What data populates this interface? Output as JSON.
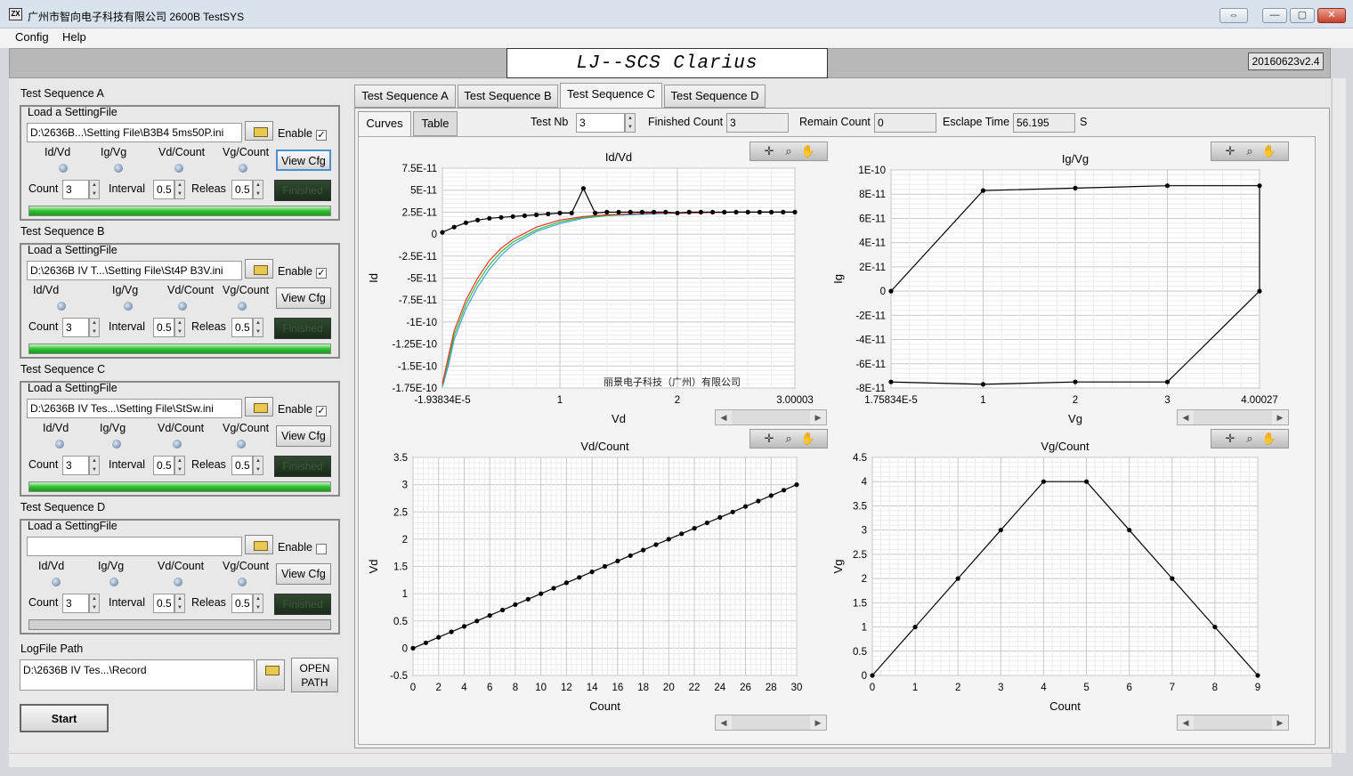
{
  "window": {
    "icon_text": "ZX",
    "title": "广州市智向电子科技有限公司 2600B TestSYS",
    "restore": "⇔",
    "minimize": "—",
    "maximize": "▢",
    "close": "✕"
  },
  "menu": {
    "config": "Config",
    "help": "Help"
  },
  "banner": {
    "title": "LJ--SCS Clarius",
    "version": "20160623v2.4"
  },
  "sequences": [
    {
      "title": "Test Sequence A",
      "load_label": "Load a SettingFile",
      "path": "D:\\2636B...\\Setting File\\B3B4 5ms50P.ini",
      "enable_label": "Enable",
      "enabled": "✓",
      "radios": [
        "Id/Vd",
        "Ig/Vg",
        "Vd/Count",
        "Vg/Count"
      ],
      "view_cfg": "View Cfg",
      "count_label": "Count",
      "count": "3",
      "interval_label": "Interval",
      "interval": "0.5",
      "releas_label": "Releas",
      "releas": "0.5",
      "status": "Finished",
      "progress": 1.0
    },
    {
      "title": "Test Sequence B",
      "load_label": "Load a SettingFile",
      "path": "D:\\2636B IV T...\\Setting File\\St4P B3V.ini",
      "enable_label": "Enable",
      "enabled": "✓",
      "radios": [
        "Id/Vd",
        "Ig/Vg",
        "Vd/Count",
        "Vg/Count"
      ],
      "view_cfg": "View Cfg",
      "count_label": "Count",
      "count": "3",
      "interval_label": "Interval",
      "interval": "0.5",
      "releas_label": "Releas",
      "releas": "0.5",
      "status": "Finished",
      "progress": 1.0
    },
    {
      "title": "Test Sequence C",
      "load_label": "Load a SettingFile",
      "path": "D:\\2636B IV Tes...\\Setting File\\StSw.ini",
      "enable_label": "Enable",
      "enabled": "✓",
      "radios": [
        "Id/Vd",
        "Ig/Vg",
        "Vd/Count",
        "Vg/Count"
      ],
      "view_cfg": "View Cfg",
      "count_label": "Count",
      "count": "3",
      "interval_label": "Interval",
      "interval": "0.5",
      "releas_label": "Releas",
      "releas": "0.5",
      "status": "Finished",
      "progress": 1.0
    },
    {
      "title": "Test Sequence D",
      "load_label": "Load a SettingFile",
      "path": "",
      "enable_label": "Enable",
      "enabled": "",
      "radios": [
        "Id/Vd",
        "Ig/Vg",
        "Vd/Count",
        "Vg/Count"
      ],
      "view_cfg": "View Cfg",
      "count_label": "Count",
      "count": "3",
      "interval_label": "Interval",
      "interval": "0.5",
      "releas_label": "Releas",
      "releas": "0.5",
      "status": "Finished",
      "progress": 0.0
    }
  ],
  "log": {
    "label": "LogFile Path",
    "path": "D:\\2636B IV Tes...\\Record",
    "open_path": "OPEN PATH"
  },
  "start": "Start",
  "tabs": [
    "Test Sequence A",
    "Test Sequence B",
    "Test Sequence C",
    "Test Sequence D"
  ],
  "active_tab": 2,
  "subtabs": [
    "Curves",
    "Table"
  ],
  "stats": {
    "test_nb_label": "Test Nb",
    "test_nb": "3",
    "finished_label": "Finished Count",
    "finished": "3",
    "remain_label": "Remain Count",
    "remain": "0",
    "elapsed_label": "Esclape Time",
    "elapsed": "56.195",
    "elapsed_unit": "S"
  },
  "colors": {
    "accent_green": "#2fc02f",
    "series_red": "#e83030",
    "series_green": "#30c030",
    "series_blue": "#40a0e8",
    "series_yellow": "#c8c020"
  },
  "chart_data": [
    {
      "type": "line",
      "title": "Id/Vd",
      "xlabel": "Vd",
      "ylabel": "Id",
      "xlim": [
        -1.93834e-05,
        3.00003
      ],
      "ylim": [
        -1.75e-10,
        7.5e-11
      ],
      "xticks": [
        "-1.93834E-5",
        "1",
        "2",
        "3.00003"
      ],
      "yticks": [
        "7.5E-11",
        "5E-11",
        "2.5E-11",
        "0",
        "-2.5E-11",
        "-5E-11",
        "-7.5E-11",
        "-1E-10",
        "-1.25E-10",
        "-1.5E-10",
        "-1.75E-10"
      ],
      "annotation": "丽景电子科技（广州）有限公司",
      "series": [
        {
          "x": [
            0,
            0.1,
            0.2,
            0.3,
            0.4,
            0.5,
            0.6,
            0.7,
            0.8,
            0.9,
            1.0,
            1.1,
            1.2,
            1.3,
            1.4,
            1.5,
            1.6,
            1.7,
            1.8,
            1.9,
            2.0,
            2.1,
            2.2,
            2.3,
            2.4,
            2.5,
            2.6,
            2.7,
            2.8,
            2.9,
            3.0
          ],
          "y": [
            2e-12,
            8e-12,
            1.3e-11,
            1.6e-11,
            1.8e-11,
            1.9e-11,
            2e-11,
            2.1e-11,
            2.2e-11,
            2.3e-11,
            2.4e-11,
            2.4e-11,
            5.2e-11,
            2.4e-11,
            2.5e-11,
            2.5e-11,
            2.5e-11,
            2.5e-11,
            2.5e-11,
            2.5e-11,
            2.4e-11,
            2.5e-11,
            2.5e-11,
            2.5e-11,
            2.5e-11,
            2.5e-11,
            2.5e-11,
            2.5e-11,
            2.5e-11,
            2.5e-11,
            2.5e-11
          ]
        },
        {
          "x": [
            0,
            0.05,
            0.1,
            0.2,
            0.3,
            0.4,
            0.5,
            0.6,
            0.8,
            1.0,
            1.2,
            1.4,
            1.6,
            1.8,
            2.0,
            2.5,
            3.0
          ],
          "y": [
            -1.7e-10,
            -1.4e-10,
            -1.1e-10,
            -7.5e-11,
            -5e-11,
            -3e-11,
            -1.6e-11,
            -6e-12,
            8e-12,
            1.6e-11,
            2e-11,
            2.2e-11,
            2.3e-11,
            2.4e-11,
            2.4e-11,
            2.5e-11,
            2.5e-11
          ]
        },
        {
          "x": [
            0,
            0.05,
            0.1,
            0.2,
            0.3,
            0.4,
            0.5,
            0.6,
            0.8,
            1.0,
            1.2,
            1.4,
            1.6,
            1.8,
            2.0,
            2.5,
            3.0
          ],
          "y": [
            -1.72e-10,
            -1.45e-10,
            -1.15e-10,
            -8e-11,
            -5.5e-11,
            -3.5e-11,
            -2e-11,
            -9e-12,
            5e-12,
            1.4e-11,
            1.9e-11,
            2.1e-11,
            2.3e-11,
            2.4e-11,
            2.4e-11,
            2.5e-11,
            2.5e-11
          ]
        },
        {
          "x": [
            0,
            0.05,
            0.1,
            0.2,
            0.3,
            0.4,
            0.5,
            0.6,
            0.8,
            1.0,
            1.2,
            1.4,
            1.6,
            1.8,
            2.0,
            2.5,
            3.0
          ],
          "y": [
            -1.74e-10,
            -1.5e-10,
            -1.2e-10,
            -8.5e-11,
            -6e-11,
            -4e-11,
            -2.4e-11,
            -1.2e-11,
            3e-12,
            1.2e-11,
            1.8e-11,
            2.1e-11,
            2.2e-11,
            2.3e-11,
            2.4e-11,
            2.5e-11,
            2.5e-11
          ]
        }
      ]
    },
    {
      "type": "line",
      "title": "Ig/Vg",
      "xlabel": "Vg",
      "ylabel": "Ig",
      "xlim": [
        1.75834e-05,
        4.00027
      ],
      "ylim": [
        -8e-11,
        1e-10
      ],
      "xticks": [
        "1.75834E-5",
        "1",
        "2",
        "3",
        "4.00027"
      ],
      "yticks": [
        "1E-10",
        "8E-11",
        "6E-11",
        "4E-11",
        "2E-11",
        "0",
        "-2E-11",
        "-4E-11",
        "-6E-11",
        "-8E-11"
      ],
      "series": [
        {
          "x": [
            0,
            1,
            2,
            3,
            4,
            4,
            3,
            2,
            1,
            0
          ],
          "y": [
            0,
            8.3e-11,
            8.5e-11,
            8.7e-11,
            8.7e-11,
            0,
            -7.5e-11,
            -7.5e-11,
            -7.7e-11,
            -7.5e-11
          ]
        }
      ]
    },
    {
      "type": "line",
      "title": "Vd/Count",
      "xlabel": "Count",
      "ylabel": "Vd",
      "xlim": [
        0,
        30
      ],
      "ylim": [
        -0.5,
        3.5
      ],
      "xticks": [
        "0",
        "2",
        "4",
        "6",
        "8",
        "10",
        "12",
        "14",
        "16",
        "18",
        "20",
        "22",
        "24",
        "26",
        "28",
        "30"
      ],
      "yticks": [
        "3.5",
        "3",
        "2.5",
        "2",
        "1.5",
        "1",
        "0.5",
        "0",
        "-0.5"
      ],
      "series": [
        {
          "x": [
            0,
            1,
            2,
            3,
            4,
            5,
            6,
            7,
            8,
            9,
            10,
            11,
            12,
            13,
            14,
            15,
            16,
            17,
            18,
            19,
            20,
            21,
            22,
            23,
            24,
            25,
            26,
            27,
            28,
            29,
            30
          ],
          "y": [
            0,
            0.1,
            0.2,
            0.3,
            0.4,
            0.5,
            0.6,
            0.7,
            0.8,
            0.9,
            1.0,
            1.1,
            1.2,
            1.3,
            1.4,
            1.5,
            1.6,
            1.7,
            1.8,
            1.9,
            2.0,
            2.1,
            2.2,
            2.3,
            2.4,
            2.5,
            2.6,
            2.7,
            2.8,
            2.9,
            3.0
          ]
        }
      ]
    },
    {
      "type": "line",
      "title": "Vg/Count",
      "xlabel": "Count",
      "ylabel": "Vg",
      "xlim": [
        0,
        9
      ],
      "ylim": [
        0,
        4.5
      ],
      "xticks": [
        "0",
        "1",
        "2",
        "3",
        "4",
        "5",
        "6",
        "7",
        "8",
        "9"
      ],
      "yticks": [
        "4.5",
        "4",
        "3.5",
        "3",
        "2.5",
        "2",
        "1.5",
        "1",
        "0.5",
        "0"
      ],
      "series": [
        {
          "x": [
            0,
            1,
            2,
            3,
            4,
            5,
            6,
            7,
            8,
            9
          ],
          "y": [
            0,
            1,
            2,
            3,
            4,
            4,
            3,
            2,
            1,
            0
          ]
        }
      ]
    }
  ]
}
